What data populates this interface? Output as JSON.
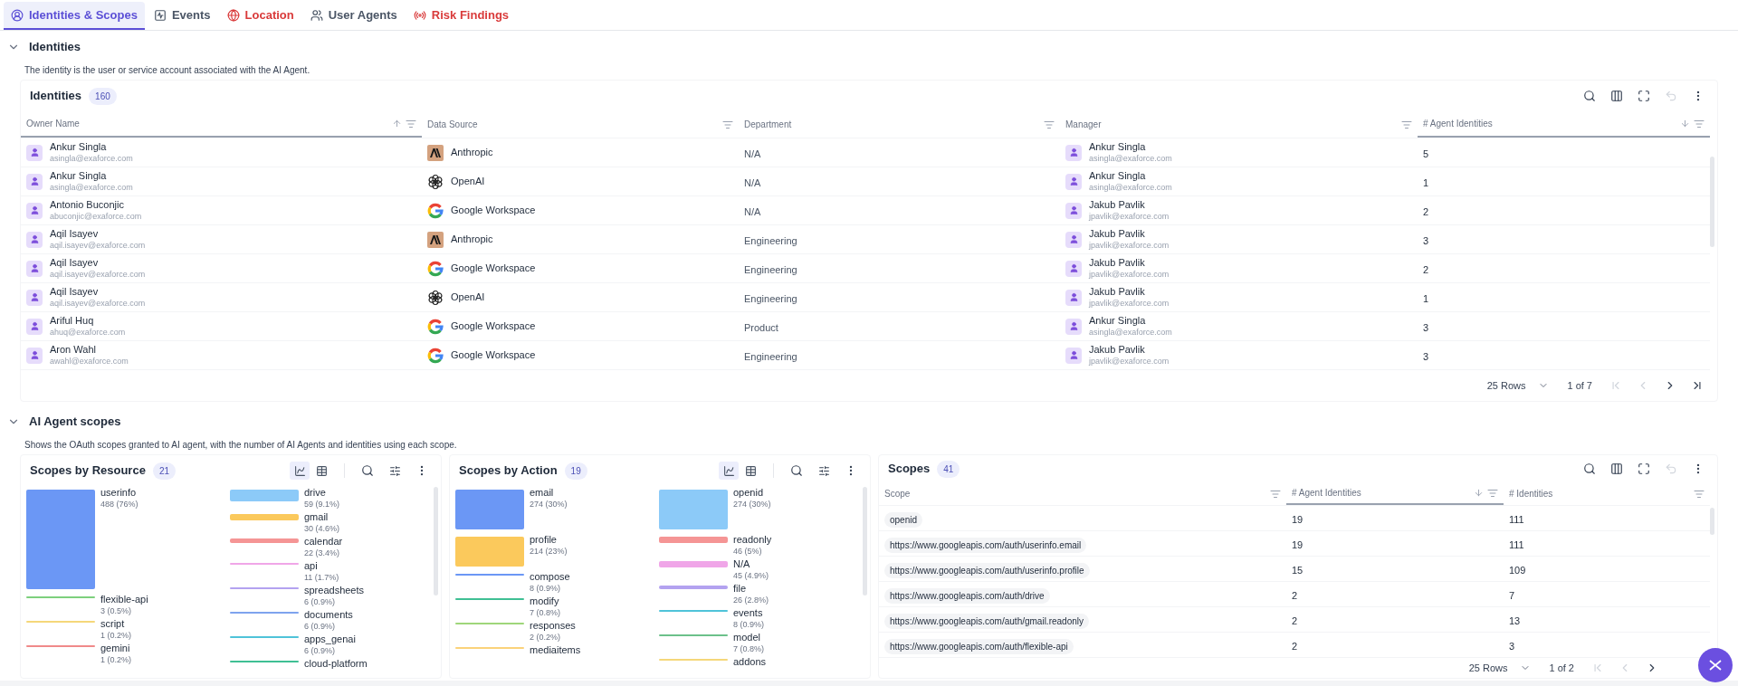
{
  "tabs": [
    {
      "label": "Identities & Scopes",
      "kind": "identity",
      "alert": false,
      "selected": true
    },
    {
      "label": "Events",
      "kind": "events",
      "alert": false,
      "selected": false
    },
    {
      "label": "Location",
      "kind": "location",
      "alert": true,
      "selected": false
    },
    {
      "label": "User Agents",
      "kind": "users",
      "alert": false,
      "selected": false
    },
    {
      "label": "Risk Findings",
      "kind": "risk",
      "alert": true,
      "selected": false
    }
  ],
  "identities_section": {
    "title": "Identities",
    "expanded": true,
    "description": "The identity is the user or service account associated with the AI Agent.",
    "table": {
      "title": "Identities",
      "count": "160",
      "toolbar": [
        {
          "kind": "search",
          "disabled": false
        },
        {
          "kind": "columns",
          "disabled": false
        },
        {
          "kind": "fullscreen",
          "disabled": false
        },
        {
          "kind": "undo",
          "disabled": true
        },
        {
          "kind": "more",
          "disabled": false
        }
      ],
      "columns": [
        {
          "label": "Owner Name",
          "sort_up": true,
          "sort_down": false
        },
        {
          "label": "Data Source",
          "sort_up": false,
          "sort_down": false
        },
        {
          "label": "Department",
          "sort_up": false,
          "sort_down": false
        },
        {
          "label": "Manager",
          "sort_up": false,
          "sort_down": false
        },
        {
          "label": "# Agent Identities",
          "sort_up": false,
          "sort_down": true
        }
      ],
      "rows": [
        {
          "owner": {
            "name": "Ankur Singla",
            "email": "asingla@exaforce.com"
          },
          "source": {
            "kind": "anthropic",
            "label": "Anthropic"
          },
          "department": "N/A",
          "manager": {
            "name": "Ankur Singla",
            "email": "asingla@exaforce.com"
          },
          "agent_identities": "5"
        },
        {
          "owner": {
            "name": "Ankur Singla",
            "email": "asingla@exaforce.com"
          },
          "source": {
            "kind": "openai",
            "label": "OpenAI"
          },
          "department": "N/A",
          "manager": {
            "name": "Ankur Singla",
            "email": "asingla@exaforce.com"
          },
          "agent_identities": "1"
        },
        {
          "owner": {
            "name": "Antonio Buconjic",
            "email": "abuconjic@exaforce.com"
          },
          "source": {
            "kind": "google",
            "label": "Google Workspace"
          },
          "department": "N/A",
          "manager": {
            "name": "Jakub Pavlik",
            "email": "jpavlik@exaforce.com"
          },
          "agent_identities": "2"
        },
        {
          "owner": {
            "name": "Aqil Isayev",
            "email": "aqil.isayev@exaforce.com"
          },
          "source": {
            "kind": "anthropic",
            "label": "Anthropic"
          },
          "department": "Engineering",
          "manager": {
            "name": "Jakub Pavlik",
            "email": "jpavlik@exaforce.com"
          },
          "agent_identities": "3"
        },
        {
          "owner": {
            "name": "Aqil Isayev",
            "email": "aqil.isayev@exaforce.com"
          },
          "source": {
            "kind": "google",
            "label": "Google Workspace"
          },
          "department": "Engineering",
          "manager": {
            "name": "Jakub Pavlik",
            "email": "jpavlik@exaforce.com"
          },
          "agent_identities": "2"
        },
        {
          "owner": {
            "name": "Aqil Isayev",
            "email": "aqil.isayev@exaforce.com"
          },
          "source": {
            "kind": "openai",
            "label": "OpenAI"
          },
          "department": "Engineering",
          "manager": {
            "name": "Jakub Pavlik",
            "email": "jpavlik@exaforce.com"
          },
          "agent_identities": "1"
        },
        {
          "owner": {
            "name": "Ariful Huq",
            "email": "ahuq@exaforce.com"
          },
          "source": {
            "kind": "google",
            "label": "Google Workspace"
          },
          "department": "Product",
          "manager": {
            "name": "Ankur Singla",
            "email": "asingla@exaforce.com"
          },
          "agent_identities": "3"
        },
        {
          "owner": {
            "name": "Aron Wahl",
            "email": "awahl@exaforce.com"
          },
          "source": {
            "kind": "google",
            "label": "Google Workspace"
          },
          "department": "Engineering",
          "manager": {
            "name": "Jakub Pavlik",
            "email": "jpavlik@exaforce.com"
          },
          "agent_identities": "3"
        }
      ],
      "pager": {
        "rows": "25 Rows",
        "page": "1 of 7",
        "nav": [
          {
            "kind": "first",
            "disabled": true
          },
          {
            "kind": "prev",
            "disabled": true
          },
          {
            "kind": "next",
            "disabled": false
          },
          {
            "kind": "last",
            "disabled": false
          }
        ]
      }
    }
  },
  "scopes_section": {
    "title": "AI Agent scopes",
    "expanded": true,
    "description": "Shows the OAuth scopes granted to AI agent, with the number of AI Agents and identities using each scope.",
    "charts": [
      {
        "title": "Scopes by Resource",
        "count": "21",
        "views": [
          {
            "kind": "chart",
            "selected": true
          },
          {
            "kind": "table",
            "selected": false
          }
        ],
        "columns": [
          [
            {
              "label": "userinfo",
              "value": "488 (76%)",
              "color": "#6b97f5"
            },
            {
              "label": "flexible-api",
              "value": "3 (0.5%)",
              "color": "#7dd07d"
            },
            {
              "label": "script",
              "value": "1 (0.2%)",
              "color": "#f5d77a"
            },
            {
              "label": "gemini",
              "value": "1 (0.2%)",
              "color": "#f08a8a"
            }
          ],
          [
            {
              "label": "drive",
              "value": "59 (9.1%)",
              "color": "#8ccaf8"
            },
            {
              "label": "gmail",
              "value": "30 (4.6%)",
              "color": "#fbc95c"
            },
            {
              "label": "calendar",
              "value": "22 (3.4%)",
              "color": "#f59595"
            },
            {
              "label": "api",
              "value": "11 (1.7%)",
              "color": "#f0a6e8"
            },
            {
              "label": "spreadsheets",
              "value": "6 (0.9%)",
              "color": "#b3a2f0"
            },
            {
              "label": "documents",
              "value": "6 (0.9%)",
              "color": "#7ea3ee"
            },
            {
              "label": "apps_genai",
              "value": "6 (0.9%)",
              "color": "#4fc3d9"
            },
            {
              "label": "cloud-platform",
              "color": "#3fbf94"
            }
          ]
        ]
      },
      {
        "title": "Scopes by Action",
        "count": "19",
        "views": [
          {
            "kind": "chart",
            "selected": true
          },
          {
            "kind": "table",
            "selected": false
          }
        ],
        "columns": [
          [
            {
              "label": "email",
              "value": "274 (30%)",
              "color": "#6b97f5"
            },
            {
              "label": "profile",
              "value": "214 (23%)",
              "color": "#fbc95c"
            },
            {
              "label": "compose",
              "value": "8 (0.9%)",
              "color": "#6b97f5"
            },
            {
              "label": "modify",
              "value": "7 (0.8%)",
              "color": "#3fbf94"
            },
            {
              "label": "responses",
              "value": "2 (0.2%)",
              "color": "#9fd67a"
            },
            {
              "label": "mediaitems",
              "color": "#fbd27a"
            }
          ],
          [
            {
              "label": "openid",
              "value": "274 (30%)",
              "color": "#8ccaf8"
            },
            {
              "label": "readonly",
              "value": "46 (5%)",
              "color": "#f59595"
            },
            {
              "label": "N/A",
              "value": "45 (4.9%)",
              "color": "#f0a6e8"
            },
            {
              "label": "file",
              "value": "26 (2.8%)",
              "color": "#b3a2f0"
            },
            {
              "label": "events",
              "value": "8 (0.9%)",
              "color": "#4fc3d9"
            },
            {
              "label": "model",
              "value": "7 (0.8%)",
              "color": "#6cc18a"
            },
            {
              "label": "addons",
              "color": "#f5d77a"
            }
          ]
        ]
      }
    ],
    "table": {
      "title": "Scopes",
      "count": "41",
      "toolbar": [
        {
          "kind": "search",
          "disabled": false
        },
        {
          "kind": "columns",
          "disabled": false
        },
        {
          "kind": "fullscreen",
          "disabled": false
        },
        {
          "kind": "undo",
          "disabled": true
        },
        {
          "kind": "more",
          "disabled": false
        }
      ],
      "columns": [
        {
          "label": "Scope",
          "sort_up": false,
          "sort_down": false
        },
        {
          "label": "# Agent Identities",
          "sort_up": false,
          "sort_down": true
        },
        {
          "label": "# Identities",
          "sort_up": false,
          "sort_down": false
        }
      ],
      "rows": [
        {
          "scope": "openid",
          "agent_identities": "19",
          "identities": "111"
        },
        {
          "scope": "https://www.googleapis.com/auth/userinfo.email",
          "agent_identities": "19",
          "identities": "111"
        },
        {
          "scope": "https://www.googleapis.com/auth/userinfo.profile",
          "agent_identities": "15",
          "identities": "109"
        },
        {
          "scope": "https://www.googleapis.com/auth/drive",
          "agent_identities": "2",
          "identities": "7"
        },
        {
          "scope": "https://www.googleapis.com/auth/gmail.readonly",
          "agent_identities": "2",
          "identities": "13"
        },
        {
          "scope": "https://www.googleapis.com/auth/flexible-api",
          "agent_identities": "2",
          "identities": "3"
        }
      ],
      "pager": {
        "rows": "25 Rows",
        "page": "1 of 2",
        "nav": [
          {
            "kind": "first",
            "disabled": true
          },
          {
            "kind": "prev",
            "disabled": true
          },
          {
            "kind": "next",
            "disabled": false
          }
        ]
      }
    }
  }
}
